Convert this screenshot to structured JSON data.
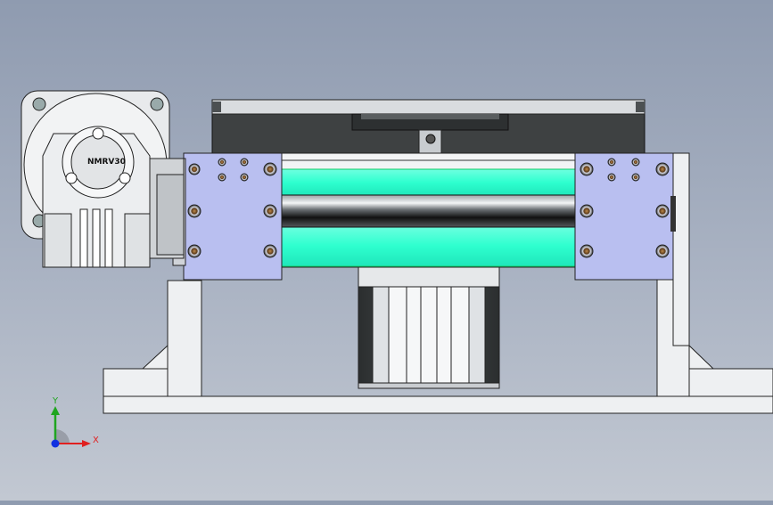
{
  "scene": {
    "gear_nameplate": "NMRV30",
    "colors": {
      "background_top": "#8f9bb0",
      "background_bottom": "#c2c8d2",
      "end_block": "#b9bff0",
      "guide_rod": "#2effcf",
      "frame": "#eef0f2",
      "motor_dark": "#3a3d3e",
      "gear_housing": "#e8eaec"
    }
  },
  "triad": {
    "x_label": "X",
    "y_label": "Y",
    "x_color": "#e02020",
    "y_color": "#1fa51f",
    "z_color": "#1030e0"
  }
}
